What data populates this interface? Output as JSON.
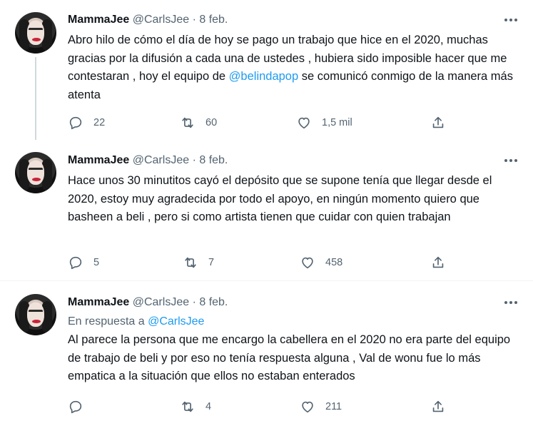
{
  "tweets": [
    {
      "name": "MammaJee",
      "handle": "@CarlsJee",
      "sep": "·",
      "date": "8 feb.",
      "text_before": "Abro hilo de cómo el día de hoy se pago un trabajo que hice en el 2020, muchas gracias por la difusión a cada una de ustedes , hubiera sido imposible hacer que me contestaran , hoy el equipo de ",
      "mention": "@belindapop",
      "text_after": " se comunicó conmigo de la manera más atenta",
      "replies": "22",
      "retweets": "60",
      "likes": "1,5 mil"
    },
    {
      "name": "MammaJee",
      "handle": "@CarlsJee",
      "sep": "·",
      "date": "8 feb.",
      "text": "Hace unos 30 minutitos cayó el depósito que se supone tenía que llegar desde el 2020, estoy muy agradecida por todo el apoyo, en ningún momento quiero que basheen a beli , pero si como artista tienen que cuidar con quien trabajan",
      "replies": "5",
      "retweets": "7",
      "likes": "458"
    },
    {
      "name": "MammaJee",
      "handle": "@CarlsJee",
      "sep": "·",
      "date": "8 feb.",
      "reply_prefix": "En respuesta a",
      "reply_handle": "@CarlsJee",
      "text": "Al parece la persona que me encargo la cabellera en el 2020 no era parte del equipo de trabajo de beli y por eso no tenía respuesta alguna , Val de wonu fue lo más empatica a la situación que ellos no estaban enterados",
      "replies": "",
      "retweets": "4",
      "likes": "211"
    }
  ],
  "icons": {
    "reply": "reply-icon",
    "retweet": "retweet-icon",
    "like": "heart-icon",
    "share": "share-icon",
    "more": "more-icon"
  },
  "colors": {
    "text": "#0f1419",
    "secondary": "#536471",
    "link": "#1d9bf0",
    "thread_line": "#cfd9de"
  }
}
